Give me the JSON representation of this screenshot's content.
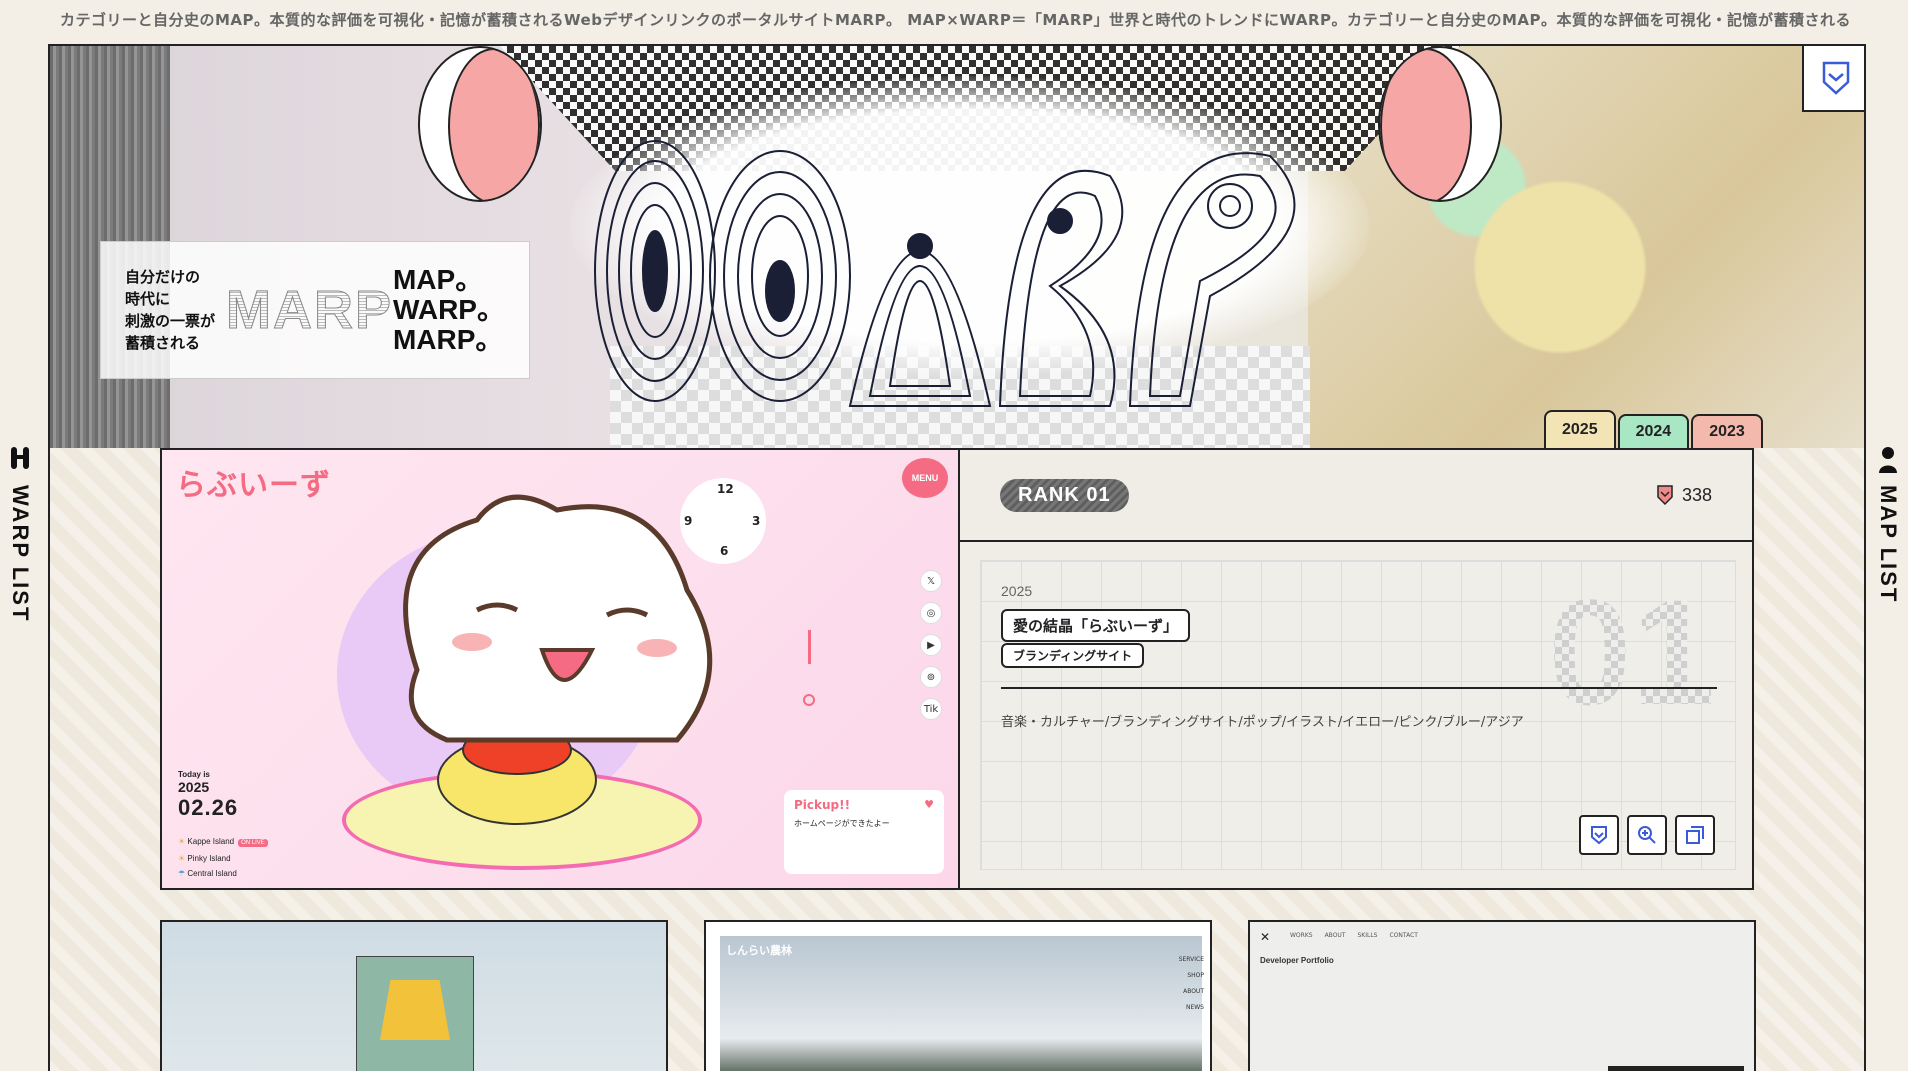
{
  "marquee": "カテゴリーと自分史のMAP。本質的な評価を可視化・記憶が蓄積されるWebデザインリンクのポータルサイトMARP。 MAP×WARP＝「MARP」世界と時代のトレンドにWARP。カテゴリーと自分史のMAP。本質的な評価を可視化・記憶が蓄積される",
  "side_left": "WARP LIST",
  "side_right": "MAP LIST",
  "hero": {
    "tagline_jp": [
      "自分だけの",
      "時代に",
      "刺激の一票が蓄積される"
    ],
    "tagline_word": "MARP",
    "tagline_lines": [
      "MAP。",
      "WARP。",
      "MARP。"
    ]
  },
  "year_tabs": [
    "2025",
    "2024",
    "2023"
  ],
  "featured": {
    "rank": "RANK 01",
    "warp_count": "338",
    "year": "2025",
    "title": "愛の結晶「らぶいーず」",
    "category": "ブランディングサイト",
    "tags": "音楽・カルチャー/ブランディングサイト/ポップ/イラスト/イエロー/ピンク/ブルー/アジア",
    "big_number": "01",
    "shot": {
      "brand": "らぶいーず",
      "menu": "MENU",
      "clock": [
        "12",
        "3",
        "6",
        "9"
      ],
      "social": [
        "𝕏",
        "◎",
        "▶",
        "⊚",
        "Tik"
      ],
      "today_label": "Today is",
      "date_year": "2025",
      "date_md": "02.26",
      "islands": [
        "Kappe Island",
        "Pinky Island",
        "Central Island"
      ],
      "live_badge": "ON LIVE",
      "pickup_title": "Pickup!!",
      "pickup_text": "ホームページができたよー",
      "pickup_heart": "♥"
    }
  },
  "cards": {
    "c2_label": "しんらい農林",
    "c2_menu": [
      "SERVICE",
      "SHOP",
      "ABOUT",
      "NEWS"
    ],
    "c3_x": "✕",
    "c3_nav": [
      "WORKS",
      "ABOUT",
      "SKILLS",
      "CONTACT"
    ],
    "c3_heading": "Developer Portfolio"
  },
  "colors": {
    "accent_pink": "#f46b83",
    "tab_2025": "#f3e4b6",
    "tab_2024": "#a8e6c4",
    "tab_2023": "#f4b9ad",
    "moon_pink": "#f7a6a6"
  }
}
